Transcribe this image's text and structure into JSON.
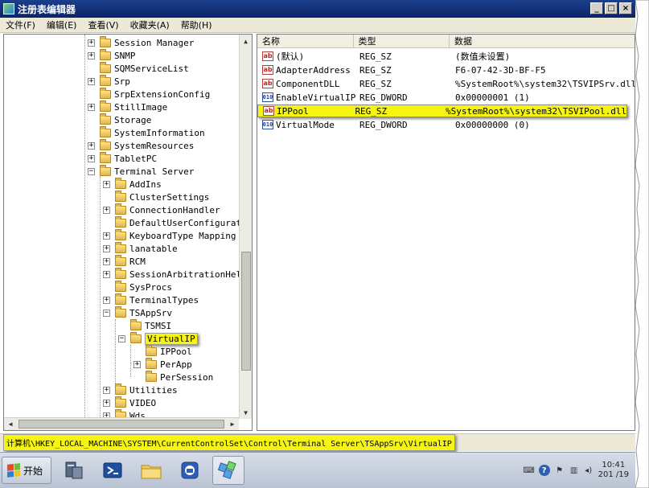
{
  "window": {
    "title": "注册表编辑器",
    "minimize_glyph": "_",
    "maximize_glyph": "□",
    "close_glyph": "×"
  },
  "menu": {
    "items": [
      {
        "label": "文件(F)"
      },
      {
        "label": "编辑(E)"
      },
      {
        "label": "查看(V)"
      },
      {
        "label": "收藏夹(A)"
      },
      {
        "label": "帮助(H)"
      }
    ]
  },
  "tree": {
    "items": [
      {
        "label": "Session Manager",
        "exp": "+"
      },
      {
        "label": "SNMP",
        "exp": "+"
      },
      {
        "label": "SQMServiceList",
        "exp": ""
      },
      {
        "label": "Srp",
        "exp": "+"
      },
      {
        "label": "SrpExtensionConfig",
        "exp": ""
      },
      {
        "label": "StillImage",
        "exp": "+"
      },
      {
        "label": "Storage",
        "exp": ""
      },
      {
        "label": "SystemInformation",
        "exp": ""
      },
      {
        "label": "SystemResources",
        "exp": "+"
      },
      {
        "label": "TabletPC",
        "exp": "+"
      },
      {
        "label": "Terminal Server",
        "exp": "−"
      },
      {
        "label": "AddIns",
        "exp": "+"
      },
      {
        "label": "ClusterSettings",
        "exp": ""
      },
      {
        "label": "ConnectionHandler",
        "exp": "+"
      },
      {
        "label": "DefaultUserConfiguratio",
        "exp": ""
      },
      {
        "label": "KeyboardType Mapping",
        "exp": "+"
      },
      {
        "label": "lanatable",
        "exp": "+"
      },
      {
        "label": "RCM",
        "exp": "+"
      },
      {
        "label": "SessionArbitrationHelpe",
        "exp": "+"
      },
      {
        "label": "SysProcs",
        "exp": ""
      },
      {
        "label": "TerminalTypes",
        "exp": "+"
      },
      {
        "label": "TSAppSrv",
        "exp": "−"
      },
      {
        "label": "TSMSI",
        "exp": ""
      },
      {
        "label": "VirtualIP",
        "exp": "−"
      },
      {
        "label": "IPPool",
        "exp": ""
      },
      {
        "label": "PerApp",
        "exp": "+"
      },
      {
        "label": "PerSession",
        "exp": ""
      },
      {
        "label": "Utilities",
        "exp": "+"
      },
      {
        "label": "VIDEO",
        "exp": "+"
      },
      {
        "label": "Wds",
        "exp": "+"
      }
    ]
  },
  "list": {
    "headers": {
      "name": "名称",
      "type": "类型",
      "data": "数据"
    },
    "rows": [
      {
        "icon": "ab",
        "name": "(默认)",
        "type": "REG_SZ",
        "data": "(数值未设置)"
      },
      {
        "icon": "ab",
        "name": "AdapterAddress",
        "type": "REG_SZ",
        "data": "F6-07-42-3D-BF-F5"
      },
      {
        "icon": "ab",
        "name": "ComponentDLL",
        "type": "REG_SZ",
        "data": "%SystemRoot%\\system32\\TSVIPSrv.dll"
      },
      {
        "icon": "bin",
        "name": "EnableVirtualIP",
        "type": "REG_DWORD",
        "data": "0x00000001 (1)"
      },
      {
        "icon": "ab",
        "name": "IPPool",
        "type": "REG_SZ",
        "data": "%SystemRoot%\\system32\\TSVIPool.dll"
      },
      {
        "icon": "bin",
        "name": "VirtualMode",
        "type": "REG_DWORD",
        "data": "0x00000000 (0)"
      }
    ],
    "icon_labels": {
      "ab": "ab",
      "bin": "010"
    }
  },
  "status": {
    "path": "计算机\\HKEY_LOCAL_MACHINE\\SYSTEM\\CurrentControlSet\\Control\\Terminal Server\\TSAppSrv\\VirtualIP"
  },
  "taskbar": {
    "start_label": "开始",
    "clock_time": "10:41",
    "clock_date": "201 /19"
  },
  "colors": {
    "highlight": "#f5f511",
    "title_bar": "#0a246a"
  }
}
